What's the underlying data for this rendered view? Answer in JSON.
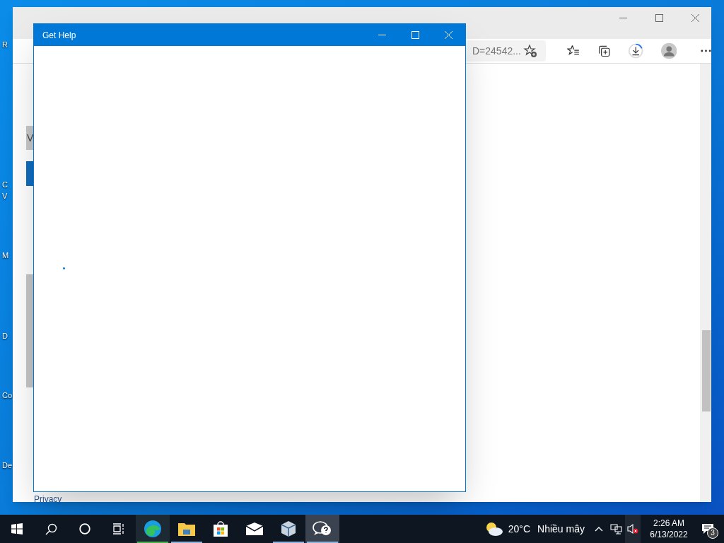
{
  "desktop": {
    "icon_labels": [
      {
        "text": "R"
      },
      {
        "text": "C"
      },
      {
        "text": "V"
      },
      {
        "text": "M"
      },
      {
        "text": "D"
      },
      {
        "text": "Co"
      },
      {
        "text": "De"
      }
    ]
  },
  "browser": {
    "address_fragment": "D=24542...",
    "page": {
      "heading_fragment": "V",
      "footer_link": "Privacy"
    }
  },
  "dialog": {
    "title": "Get Help"
  },
  "taskbar": {
    "apps": [
      {
        "kind": "edge",
        "running": true,
        "selected": false
      },
      {
        "kind": "explorer",
        "running": true,
        "selected": false
      },
      {
        "kind": "store",
        "running": false,
        "selected": false
      },
      {
        "kind": "mail",
        "running": false,
        "selected": false
      },
      {
        "kind": "virtualbox",
        "running": true,
        "selected": false
      },
      {
        "kind": "gethelp",
        "running": true,
        "selected": true
      }
    ],
    "weather": {
      "temperature": "20°C",
      "condition": "Nhiều mây"
    },
    "clock": {
      "time": "2:26 AM",
      "date": "6/13/2022"
    },
    "notifications": {
      "count": "3"
    }
  }
}
